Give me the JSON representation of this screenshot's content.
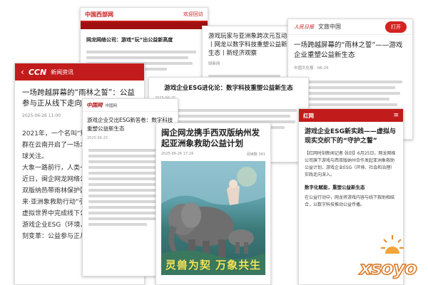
{
  "card_a": {
    "site_name": "中国西部网",
    "tag": "欢迎回访",
    "title": "网龙网络公司：游戏“玩”出公益新高度"
  },
  "card_b": {
    "title": "游戏玩家与亚洲象跨次元互动丨网龙以数字科技重塑公益新生态丨新经济观察",
    "meta": "财新网"
  },
  "card_c": {
    "logo": "人民日报",
    "header_title": "文旅中国",
    "open_button": "打开",
    "title": "一场跨越屏幕的“雨林之誓”——游戏企业重塑公益新生态",
    "meta": "中国文化报 · 06-25"
  },
  "card_d": {
    "back_icon": "‹",
    "logo": "CCN",
    "header_title": "新闻资讯",
    "title": "一场跨越屏幕的“雨林之誓”：公益参与正从线下走向虚拟数字生态",
    "meta": "2025-06-26 11:00",
    "paragraphs": [
      "2021年，一个名叫“短鼻家族”的亚洲象群在云南开启了一场北移之旅，引发全球关注。",
      "大象一路前行，人类一路守护……",
      "近日，闽企网龙网络公司旗下游戏与西双版纳热带雨林保护区合作，将“象往未来·亚洲象救助行动”引入游戏，让玩家在虚拟世界中完成线下公益。",
      "游戏企业ESG（环境、社会和治理）深刻变革：公益参与正从线下……"
    ]
  },
  "card_e": {
    "title": "游戏企业ESG进化论：数字科技重塑公益新生态",
    "meta": "2025-06-25"
  },
  "card_f": {
    "logo": "中国网",
    "header_title": "中国网",
    "title": "游戏企业交出ESG新答卷：数字科技重塑公益新生态",
    "meta": "2025-06-25"
  },
  "card_g": {
    "title": "闽企网龙携手西双版纳州发起亚洲象救助公益计划",
    "meta_left": "2025-06-26 17:24",
    "meta_right": "阅读数 341",
    "banner": "灵兽为契 万象共生"
  },
  "card_h": {
    "logo": "红网",
    "menu_icon": "≡",
    "title": "游戏企业ESG新实践——虚拟与现实交织下的“守护之誓”",
    "para1": "【红网时刻新闻记者 张剑】6月25日，网龙网络公司旗下游戏与西双版纳州合作发起亚洲象救助公益计划，游戏企业ESG（环境、社会和治理）实践走向深入。",
    "subheading": "数字化赋能，重塑公益新生态",
    "para2": "在公益行动中，网龙将游戏内容与线下救助相结合，以数字科技推动公益传播。"
  },
  "watermark": {
    "text": "xsoyo"
  },
  "colors": {
    "accent_red": "#c21b1b",
    "banner_yellow": "#f5e35a",
    "watermark_orange": "#d9731c"
  }
}
